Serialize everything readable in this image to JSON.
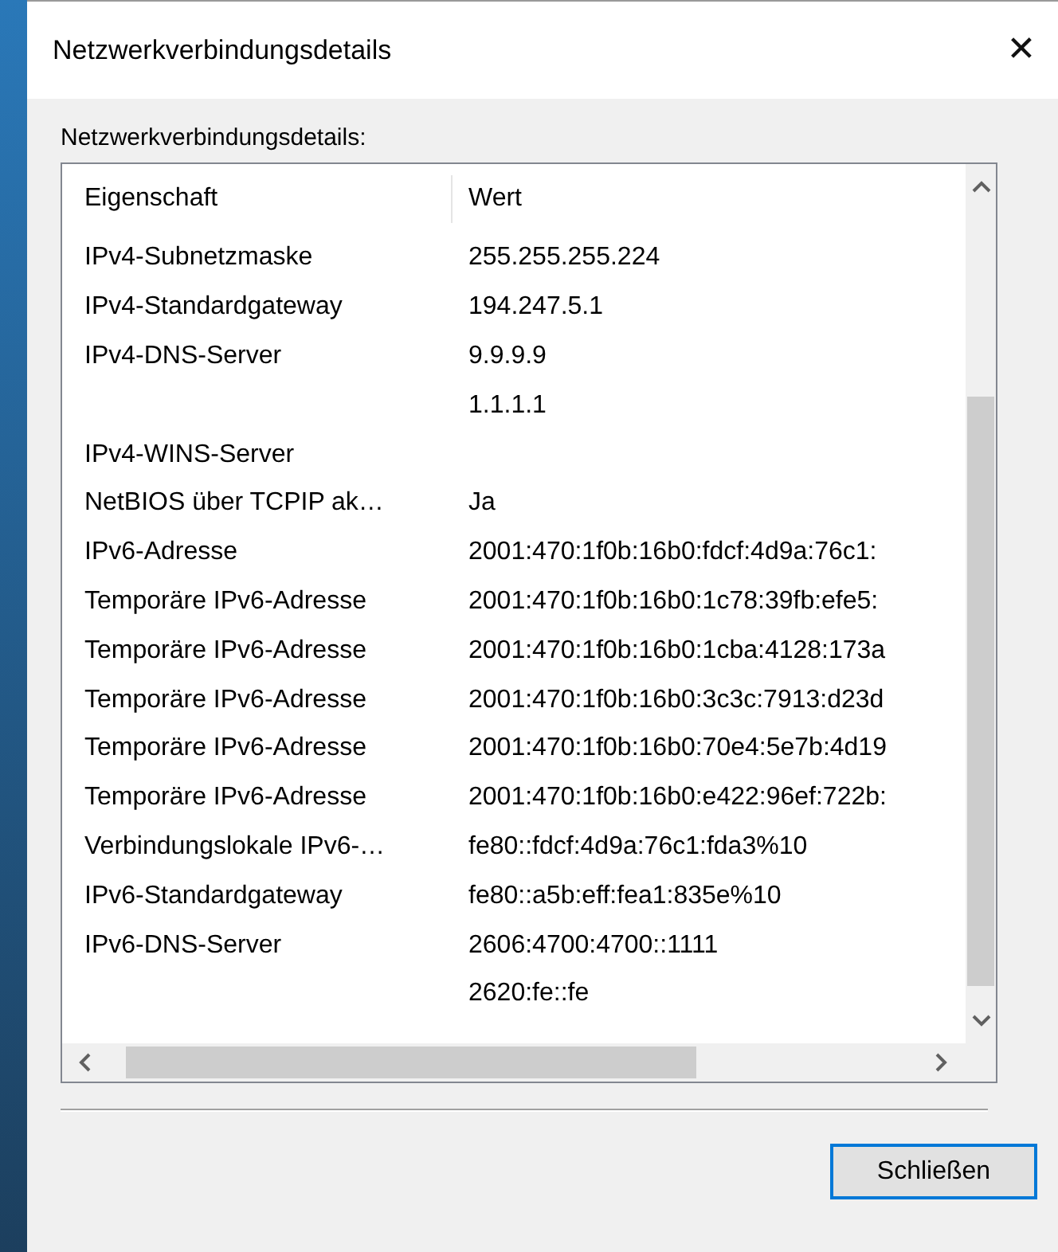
{
  "window": {
    "title": "Netzwerkverbindungsdetails",
    "close_glyph": "✕"
  },
  "group_label": "Netzwerkverbindungsdetails:",
  "table": {
    "columns": [
      "Eigenschaft",
      "Wert"
    ],
    "rows": [
      {
        "property": "IPv4-Subnetzmaske",
        "value": "255.255.255.224"
      },
      {
        "property": "IPv4-Standardgateway",
        "value": "194.247.5.1"
      },
      {
        "property": "IPv4-DNS-Server",
        "value": "9.9.9.9"
      },
      {
        "value": "1.1.1.1"
      },
      {
        "property": "IPv4-WINS-Server"
      },
      {
        "property": "NetBIOS über TCPIP ak…",
        "value": "Ja"
      },
      {
        "property": "IPv6-Adresse",
        "value": "2001:470:1f0b:16b0:fdcf:4d9a:76c1:"
      },
      {
        "property": "Temporäre IPv6-Adresse",
        "value": "2001:470:1f0b:16b0:1c78:39fb:efe5:"
      },
      {
        "property": "Temporäre IPv6-Adresse",
        "value": "2001:470:1f0b:16b0:1cba:4128:173a"
      },
      {
        "property": "Temporäre IPv6-Adresse",
        "value": "2001:470:1f0b:16b0:3c3c:7913:d23d"
      },
      {
        "property": "Temporäre IPv6-Adresse",
        "value": "2001:470:1f0b:16b0:70e4:5e7b:4d19"
      },
      {
        "property": "Temporäre IPv6-Adresse",
        "value": "2001:470:1f0b:16b0:e422:96ef:722b:"
      },
      {
        "property": "Verbindungslokale IPv6-…",
        "value": "fe80::fdcf:4d9a:76c1:fda3%10"
      },
      {
        "property": "IPv6-Standardgateway",
        "value": "fe80::a5b:eff:fea1:835e%10"
      },
      {
        "property": "IPv6-DNS-Server",
        "value": "2606:4700:4700::1111"
      },
      {
        "value": "2620:fe::fe"
      }
    ]
  },
  "buttons": [
    {
      "label": "Schließen",
      "default": true
    }
  ]
}
